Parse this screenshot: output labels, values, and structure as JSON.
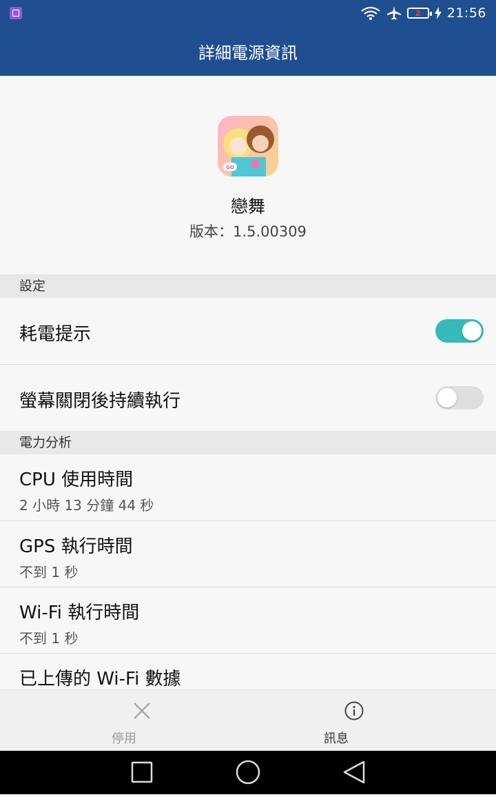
{
  "status_bar": {
    "battery_level": "2",
    "time": "21:56"
  },
  "app_bar": {
    "title": "詳細電源資訊"
  },
  "app_info": {
    "name": "戀舞",
    "version": "版本：1.5.00309"
  },
  "sections": {
    "settings_header": "設定",
    "analysis_header": "電力分析"
  },
  "settings": {
    "power_hint": {
      "label": "耗電提示",
      "enabled": true
    },
    "keep_running": {
      "label": "螢幕關閉後持續執行",
      "enabled": false
    }
  },
  "analysis": {
    "cpu": {
      "label": "CPU 使用時間",
      "value": "2 小時 13 分鐘 44 秒"
    },
    "gps": {
      "label": "GPS 執行時間",
      "value": "不到 1 秒"
    },
    "wifi": {
      "label": "Wi-Fi 執行時間",
      "value": "不到 1 秒"
    },
    "wifi_upload": {
      "label": "已上傳的 Wi-Fi 數據"
    }
  },
  "actions": {
    "disable": {
      "label": "停用",
      "icon": "close-icon"
    },
    "info": {
      "label": "訊息",
      "icon": "info-icon"
    }
  },
  "colors": {
    "primary": "#1f4f91",
    "toggle_on": "#36b9b9",
    "toggle_off": "#dedede"
  }
}
